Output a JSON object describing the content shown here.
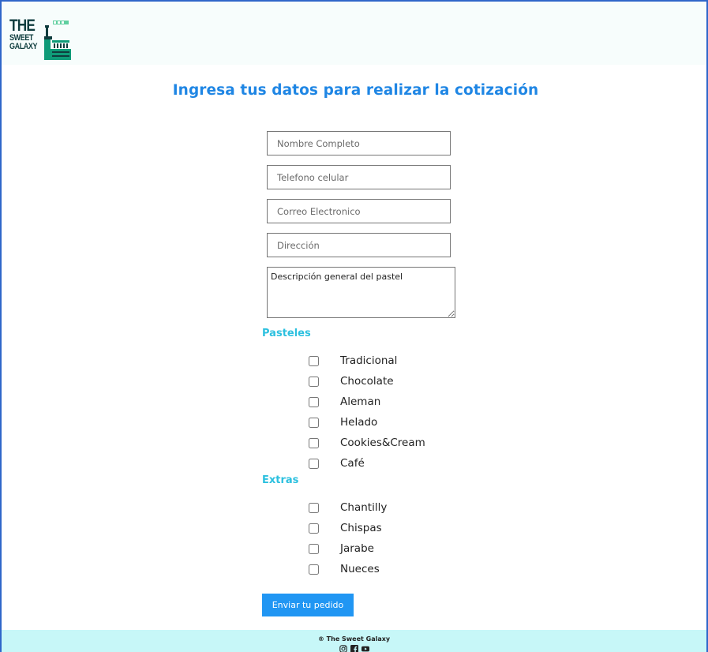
{
  "header": {
    "logo": {
      "line1": "THE",
      "line2": "SWEET",
      "line3": "GALAXY",
      "icon": "castle-building-icon",
      "colors": {
        "text": "#0f3d3e",
        "accent": "#0f9b78"
      }
    }
  },
  "page": {
    "title": "Ingresa tus datos para realizar la cotización"
  },
  "form": {
    "fields": [
      {
        "placeholder": "Nombre Completo",
        "value": ""
      },
      {
        "placeholder": "Telefono celular",
        "value": ""
      },
      {
        "placeholder": "Correo Electronico",
        "value": ""
      },
      {
        "placeholder": "Dirección",
        "value": ""
      }
    ],
    "description": {
      "placeholder": "Descripción general del pastel",
      "value": ""
    },
    "pasteles": {
      "label": "Pasteles",
      "options": [
        "Tradicional",
        "Chocolate",
        "Aleman",
        "Helado",
        "Cookies&Cream",
        "Café"
      ]
    },
    "extras": {
      "label": "Extras",
      "options": [
        "Chantilly",
        "Chispas",
        "Jarabe",
        "Nueces"
      ]
    },
    "submit_label": "Enviar tu pedido"
  },
  "footer": {
    "copyright": "® The Sweet Galaxy",
    "social_icons": [
      "instagram-icon",
      "facebook-icon",
      "youtube-icon"
    ]
  },
  "colors": {
    "title": "#1f86e4",
    "section_label": "#2cc0df",
    "button": "#2196f3",
    "footer_bg": "#c7f7f8",
    "frame_border": "#2f66c9"
  }
}
